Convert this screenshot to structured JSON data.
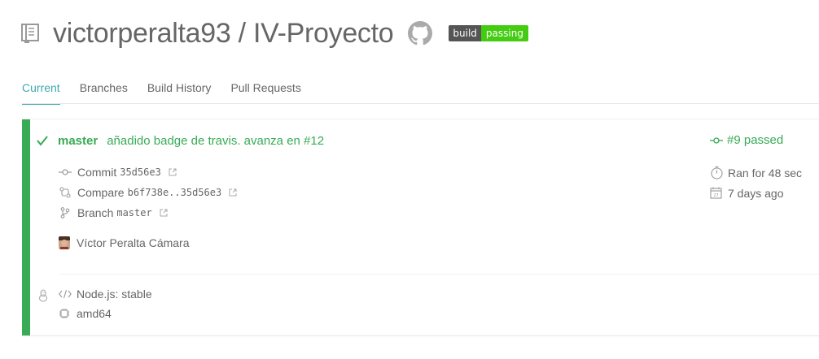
{
  "repo": {
    "title": "victorperalta93 / IV-Proyecto"
  },
  "badge": {
    "left": "build",
    "right": "passing",
    "right_color": "#44cc11"
  },
  "tabs": [
    {
      "label": "Current",
      "active": true
    },
    {
      "label": "Branches"
    },
    {
      "label": "Build History"
    },
    {
      "label": "Pull Requests"
    }
  ],
  "build": {
    "status_color": "#39aa56",
    "branch": "master",
    "message": "añadido badge de travis. avanza en #12",
    "number": "#9 passed",
    "commit_label": "Commit",
    "commit_sha": "35d56e3",
    "compare_label": "Compare",
    "compare_range": "b6f738e..35d56e3",
    "branch_label": "Branch",
    "branch_name": "master",
    "author": "Víctor Peralta Cámara",
    "duration": "Ran for 48 sec",
    "finished": "7 days ago"
  },
  "environment": {
    "language": "Node.js: stable",
    "arch": "amd64"
  },
  "icons": [
    "repo-icon",
    "github-icon",
    "check-icon",
    "commit-icon",
    "compare-icon",
    "branch-icon",
    "external-link-icon",
    "stopwatch-icon",
    "calendar-icon",
    "linux-icon",
    "code-icon",
    "cpu-icon"
  ]
}
